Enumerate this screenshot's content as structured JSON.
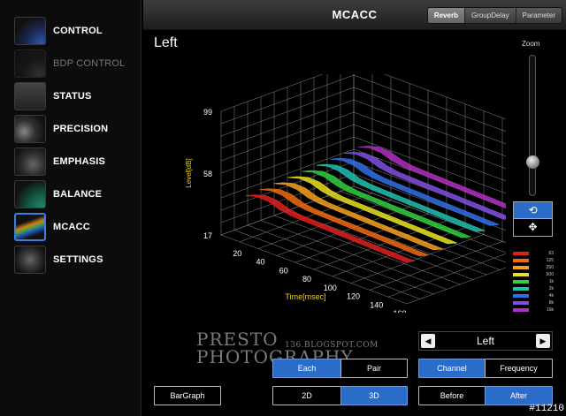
{
  "sidebar": {
    "items": [
      {
        "label": "CONTROL",
        "dim": false,
        "active": false
      },
      {
        "label": "BDP CONTROL",
        "dim": true,
        "active": false
      },
      {
        "label": "STATUS",
        "dim": false,
        "active": false
      },
      {
        "label": "PRECISION",
        "dim": false,
        "active": false
      },
      {
        "label": "EMPHASIS",
        "dim": false,
        "active": false
      },
      {
        "label": "BALANCE",
        "dim": false,
        "active": false
      },
      {
        "label": "MCACC",
        "dim": false,
        "active": true
      },
      {
        "label": "SETTINGS",
        "dim": false,
        "active": false
      }
    ]
  },
  "header": {
    "title": "MCACC",
    "tabs": [
      "Reverb",
      "GroupDelay",
      "Parameter"
    ],
    "selected_tab": "Reverb"
  },
  "panel": {
    "title": "Left",
    "zoom_label": "Zoom",
    "zoom_level": 0.25
  },
  "mode_buttons": {
    "rotate_icon": "rotate-icon",
    "move_icon": "move-icon",
    "rotate_glyph": "⟲",
    "move_glyph": "✥"
  },
  "chart_data": {
    "type": "surface-3d",
    "ylabel": "Level[dB]",
    "xlabel": "Time[msec]",
    "y_ticks": [
      "99",
      "58",
      "17"
    ],
    "x_ticks": [
      "20",
      "40",
      "60",
      "80",
      "100",
      "120",
      "140",
      "160"
    ],
    "z_tick": "60",
    "series": [
      {
        "name": "63",
        "color": "#e02020"
      },
      {
        "name": "125",
        "color": "#f06a10"
      },
      {
        "name": "250",
        "color": "#f4a020"
      },
      {
        "name": "500",
        "color": "#e8e020"
      },
      {
        "name": "1k",
        "color": "#30d040"
      },
      {
        "name": "2k",
        "color": "#20c0b0"
      },
      {
        "name": "4k",
        "color": "#3070e8"
      },
      {
        "name": "8k",
        "color": "#8050e0"
      },
      {
        "name": "16k",
        "color": "#b030c0"
      }
    ]
  },
  "channel": {
    "name": "Left",
    "prev": "◀",
    "next": "▶"
  },
  "buttons": {
    "each": "Each",
    "pair": "Pair",
    "channel": "Channel",
    "frequency": "Frequency",
    "bargraph": "BarGraph",
    "two_d": "2D",
    "three_d": "3D",
    "before": "Before",
    "after": "After"
  },
  "watermark": {
    "line1": "PRESTO",
    "line2": "PHOTOGRAPHY",
    "blog": "136.BLOGSPOT.COM"
  },
  "tag": "#11210"
}
